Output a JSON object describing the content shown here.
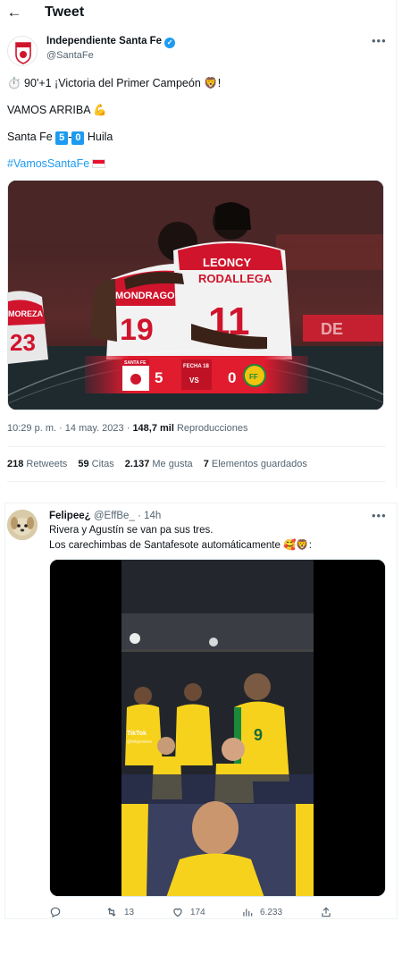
{
  "header": {
    "title": "Tweet"
  },
  "tweet": {
    "author_name": "Independiente Santa Fe",
    "author_handle": "@SantaFe",
    "line1": "⏱️ 90'+1 ¡Victoria del Primer Campeón 🦁!",
    "line2": "VAMOS ARRIBA 💪",
    "score_team1": "Santa Fe",
    "score1": "5",
    "score_dash": "-",
    "score2": "0",
    "score_team2": "Huila",
    "hashtag": "#VamosSantaFe",
    "media": {
      "banner_team1": "SANTA FE",
      "banner_score1": "5",
      "banner_fecha": "FECHA 18",
      "banner_vs": "VS",
      "banner_score2": "0",
      "banner_team2_badge": "FF",
      "jersey_sponsor": "LEONCY",
      "jersey_name_back": "RODALLEGA",
      "jersey_number_back": "11",
      "jersey_number_left": "19",
      "jersey_name_left": "MONDRAGO",
      "jersey_number_far_left": "23",
      "jersey_name_far_left": "MOREZA",
      "board_text": "DE"
    },
    "time": "10:29 p. m. · 14 may. 2023 ·",
    "views": "148,7 mil",
    "views_label": "Reproducciones",
    "stats": {
      "retweets": "218",
      "retweets_label": "Retweets",
      "quotes": "59",
      "quotes_label": "Citas",
      "likes": "2.137",
      "likes_label": "Me gusta",
      "bookmarks": "7",
      "bookmarks_label": "Elementos guardados"
    }
  },
  "reply": {
    "name": "Felipee¿",
    "handle": "@EffBe_",
    "time": "· 14h",
    "line1": "Rivera y Agustín se van pa sus tres.",
    "line2": "Los carechimbas de Santafesote automáticamente 🥰🦁:",
    "media": {
      "tiktok_label": "TikTok",
      "tiktok_handle": "@felipewww",
      "jersey_number": "9"
    },
    "actions": {
      "reply": "",
      "retweets": "13",
      "likes": "174",
      "views": "6.233"
    }
  },
  "colors": {
    "accent": "#1d9bf0",
    "santafe_red": "#d0142c"
  }
}
